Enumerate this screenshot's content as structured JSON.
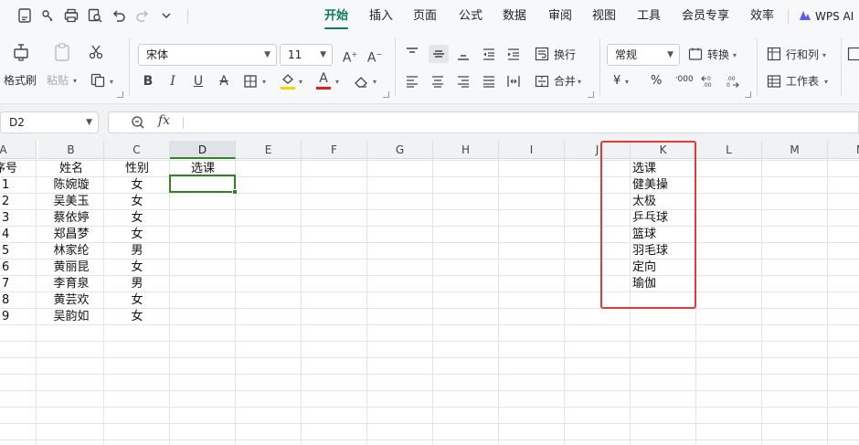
{
  "menu": {
    "tabs": [
      "开始",
      "插入",
      "页面",
      "公式",
      "数据",
      "审阅",
      "视图",
      "工具",
      "会员专享",
      "效率"
    ],
    "active_tab": "开始",
    "ai_label": "WPS AI"
  },
  "ribbon": {
    "format_painter": "格式刷",
    "paste": "粘贴",
    "font_name": "宋体",
    "font_size": "11",
    "wrap_text": "换行",
    "merge": "合并",
    "number_format": "常规",
    "convert": "转换",
    "rows_cols": "行和列",
    "worksheet": "工作表",
    "currency_symbol": "¥",
    "percent_symbol": "%",
    "thousands_symbol": "000",
    "bold": "B",
    "italic": "I",
    "underline": "U",
    "strikethrough": "A",
    "font_color_letter": "A",
    "grow_font": "A",
    "shrink_font": "A",
    "font_color_bar": "#e02020",
    "fill_color_bar": "#f5d400"
  },
  "formula_bar": {
    "name_box": "D2",
    "fx_label": "fx",
    "formula": ""
  },
  "sheet": {
    "columns": [
      "A",
      "B",
      "C",
      "D",
      "E",
      "F",
      "G",
      "H",
      "I",
      "J",
      "K",
      "L",
      "M",
      "N"
    ],
    "selected_column": "D",
    "header_row": {
      "a": "序号",
      "b": "姓名",
      "c": "性别",
      "d": "选课"
    },
    "rows": [
      {
        "a": "1",
        "b": "陈婉璇",
        "c": "女"
      },
      {
        "a": "2",
        "b": "吴美玉",
        "c": "女"
      },
      {
        "a": "3",
        "b": "蔡依婷",
        "c": "女"
      },
      {
        "a": "4",
        "b": "郑昌梦",
        "c": "女"
      },
      {
        "a": "5",
        "b": "林家纶",
        "c": "男"
      },
      {
        "a": "6",
        "b": "黄丽昆",
        "c": "女"
      },
      {
        "a": "7",
        "b": "李育泉",
        "c": "男"
      },
      {
        "a": "8",
        "b": "黄芸欢",
        "c": "女"
      },
      {
        "a": "9",
        "b": "吴韵如",
        "c": "女"
      }
    ],
    "k_list": [
      "选课",
      "健美操",
      "太极",
      "乒乓球",
      "篮球",
      "羽毛球",
      "定向",
      "瑜伽"
    ],
    "accent_green": "#3a7d2b",
    "highlight_red": "#e53935"
  }
}
